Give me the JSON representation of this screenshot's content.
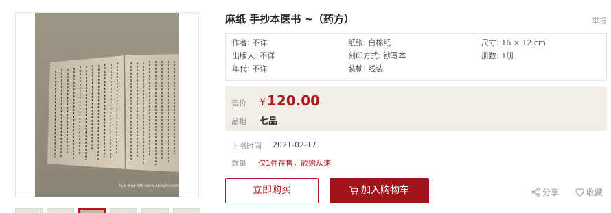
{
  "product": {
    "title": "麻纸 手抄本医书 ~（药方）",
    "report_label": "举报",
    "image_watermark": "孔夫子旧书网 www.kongfz.com"
  },
  "attributes": [
    {
      "label": "作者",
      "value": "不详"
    },
    {
      "label": "纸张",
      "value": "白棉纸"
    },
    {
      "label": "尺寸",
      "value": "16 × 12 cm"
    },
    {
      "label": "出版人",
      "value": "不详"
    },
    {
      "label": "刻印方式",
      "value": "钞写本"
    },
    {
      "label": "册数",
      "value": "1册"
    },
    {
      "label": "年代",
      "value": "不详"
    },
    {
      "label": "装帧",
      "value": "线装"
    }
  ],
  "attribute_texts": [
    "作者: 不详",
    "纸张: 白棉纸",
    "尺寸: 16 × 12 cm",
    "出版人: 不详",
    "刻印方式: 钞写本",
    "册数: 1册",
    "年代: 不详",
    "装帧: 线装"
  ],
  "price": {
    "label": "售价",
    "currency": "¥",
    "value": "120.00",
    "condition_label": "品相",
    "condition_value": "七品"
  },
  "listing": {
    "date_label": "上书时间",
    "date_value": "2021-02-17",
    "quantity_label": "数量",
    "quantity_value": "仅1件在售，欲购从速"
  },
  "actions": {
    "buy_now": "立即购买",
    "add_to_cart": "加入购物车",
    "share": "分享",
    "favorite": "收藏"
  },
  "thumbnails": {
    "count": 6,
    "active_index": 2
  },
  "colors": {
    "accent": "#b01a1f",
    "price_bg": "#f3eee8",
    "cart_bg": "#a0151a"
  },
  "icons": [
    "cart-icon",
    "share-icon",
    "heart-icon"
  ]
}
